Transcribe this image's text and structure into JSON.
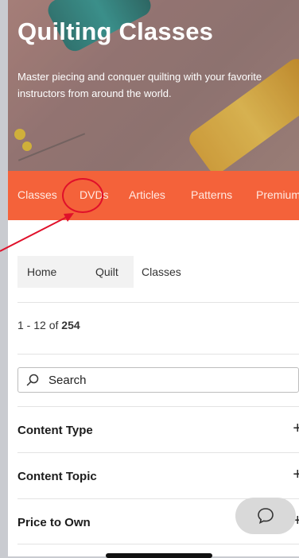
{
  "hero": {
    "title": "Quilting Classes",
    "subtitle": "Master piecing and conquer quilting with your favorite instructors from around the world."
  },
  "tabs": [
    {
      "label": "Classes"
    },
    {
      "label": "DVDs"
    },
    {
      "label": "Articles"
    },
    {
      "label": "Patterns"
    },
    {
      "label": "Premium"
    }
  ],
  "breadcrumb": {
    "items": [
      "Home",
      "Quilt",
      "Classes"
    ]
  },
  "results": {
    "range": "1 - 12",
    "of_word": "of",
    "total": "254"
  },
  "search": {
    "label": "Search",
    "icon": "search-icon"
  },
  "filters": [
    {
      "label": "Content Type",
      "toggle": "+"
    },
    {
      "label": "Content Topic",
      "toggle": "+"
    },
    {
      "label": "Price to Own",
      "toggle": "+"
    }
  ],
  "chat": {
    "icon": "chat-bubble-icon"
  },
  "colors": {
    "tab_bar": "#f4623a",
    "annotation": "#e0102a",
    "page_bg": "#ffffff",
    "side_strip": "#c9cbd0"
  }
}
